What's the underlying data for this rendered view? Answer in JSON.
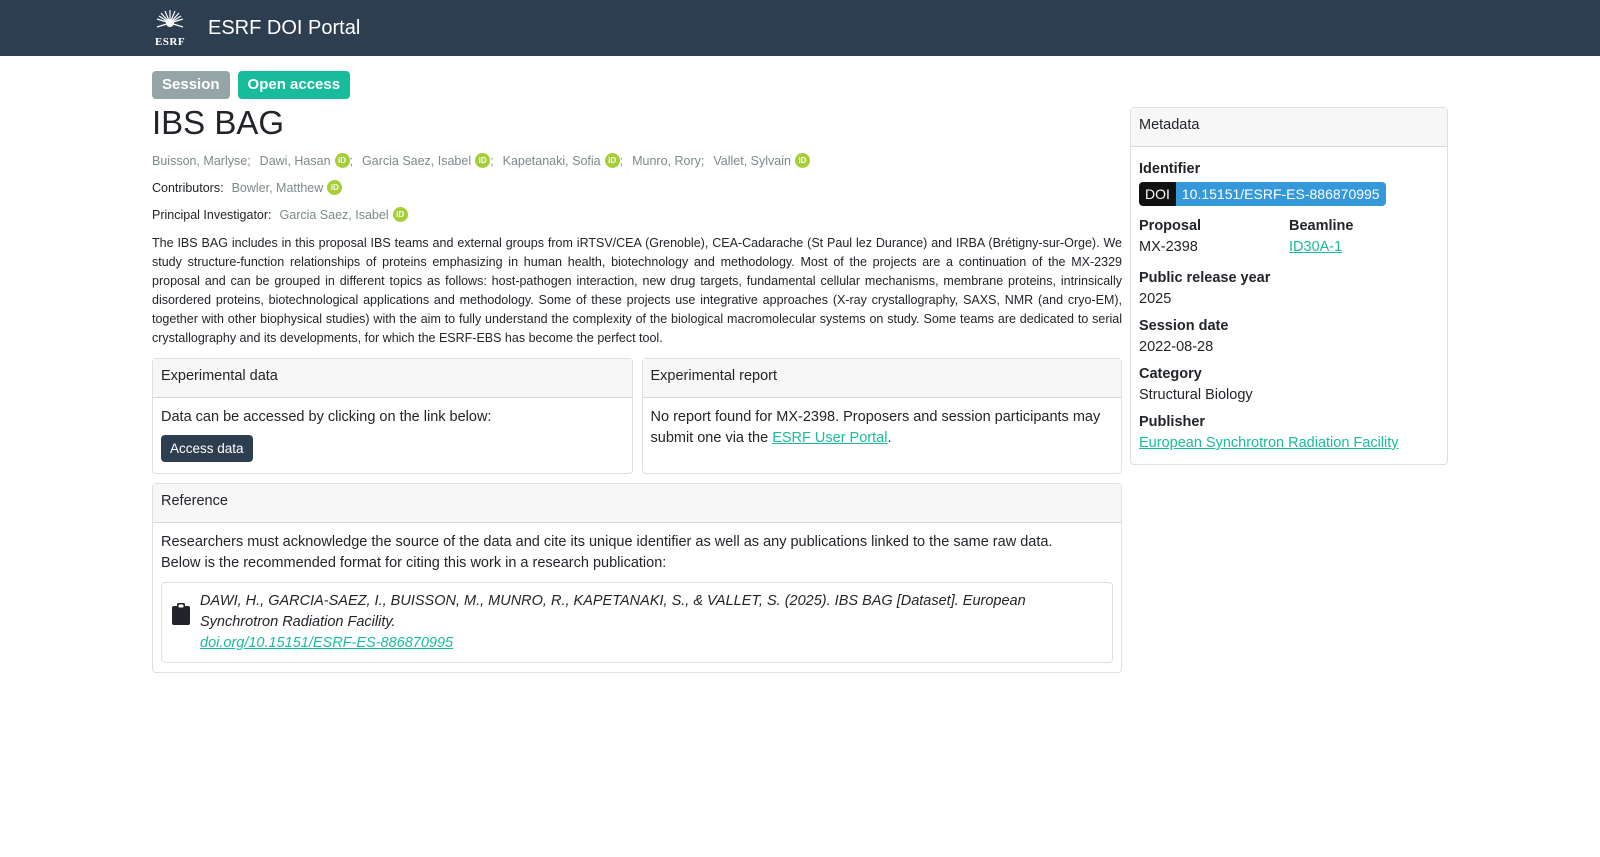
{
  "navbar": {
    "brand": "ESRF DOI Portal",
    "logo_text": "ESRF"
  },
  "badges": {
    "session": "Session",
    "access": "Open access"
  },
  "title": "IBS BAG",
  "authors": [
    {
      "name": "Buisson, Marlyse",
      "orcid": false
    },
    {
      "name": "Dawi, Hasan",
      "orcid": true
    },
    {
      "name": "Garcia Saez, Isabel",
      "orcid": true
    },
    {
      "name": "Kapetanaki, Sofia",
      "orcid": true
    },
    {
      "name": "Munro, Rory",
      "orcid": false
    },
    {
      "name": "Vallet, Sylvain",
      "orcid": true
    }
  ],
  "contributors": {
    "label": "Contributors:",
    "name": "Bowler, Matthew"
  },
  "pi": {
    "label": "Principal Investigator:",
    "name": "Garcia Saez, Isabel"
  },
  "orcid_glyph": "iD",
  "abstract": "The IBS BAG includes in this proposal IBS teams and external groups from iRTSV/CEA (Grenoble), CEA-Cadarache (St Paul lez Durance) and IRBA (Brétigny-sur-Orge). We study structure-function relationships of proteins emphasizing in human health, biotechnology and methodology. Most of the projects are a continuation of the MX-2329 proposal and can be grouped in different topics as follows: host-pathogen interaction, new drug targets, fundamental cellular mechanisms, membrane proteins, intrinsically disordered proteins, biotechnological applications and methodology. Some of these projects use integrative approaches (X-ray crystallography, SAXS, NMR (and cryo-EM), together with other biophysical studies) with the aim to fully understand the complexity of the biological macromolecular systems on study. Some teams are dedicated to serial crystallography and its developments, for which the ESRF-EBS has become the perfect tool.",
  "experimental_data": {
    "header": "Experimental data",
    "text": "Data can be accessed by clicking on the link below:",
    "button": "Access data"
  },
  "experimental_report": {
    "header": "Experimental report",
    "text_before": "No report found for MX-2398. Proposers and session participants may submit one via the ",
    "link": "ESRF User Portal",
    "text_after": "."
  },
  "reference": {
    "header": "Reference",
    "line1": "Researchers must acknowledge the source of the data and cite its unique identifier as well as any publications linked to the same raw data.",
    "line2": "Below is the recommended format for citing this work in a research publication:",
    "citation": "DAWI, H., GARCIA-SAEZ, I., BUISSON, M., MUNRO, R., KAPETANAKI, S., & VALLET, S. (2025). IBS BAG [Dataset]. European Synchrotron Radiation Facility.",
    "doi_link": "doi.org/10.15151/ESRF-ES-886870995"
  },
  "metadata": {
    "header": "Metadata",
    "identifier_label": "Identifier",
    "doi_key": "DOI",
    "doi_value": "10.15151/ESRF-ES-886870995",
    "proposal_label": "Proposal",
    "proposal": "MX-2398",
    "beamline_label": "Beamline",
    "beamline": "ID30A-1",
    "release_label": "Public release year",
    "release": "2025",
    "session_label": "Session date",
    "session": "2022-08-28",
    "category_label": "Category",
    "category": "Structural Biology",
    "publisher_label": "Publisher",
    "publisher": "European Synchrotron Radiation Facility"
  }
}
